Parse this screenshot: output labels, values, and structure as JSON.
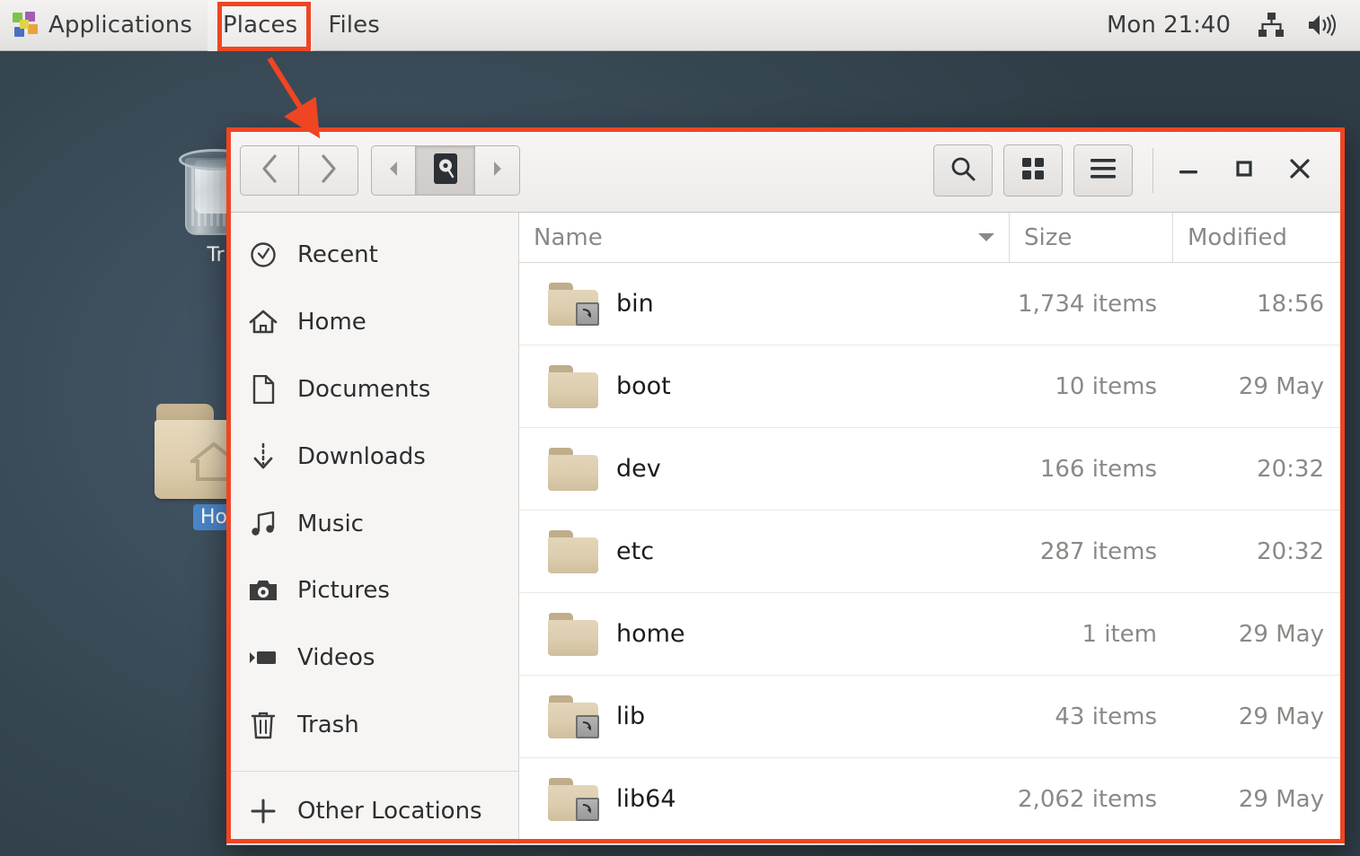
{
  "panel": {
    "app_launcher_icon": "applications-pinwheel-icon",
    "applications_label": "Applications",
    "places_label": "Places",
    "files_label": "Files",
    "clock": "Mon 21:40",
    "network_icon": "network-tree-icon",
    "volume_icon": "volume-speaker-icon"
  },
  "desktop": {
    "trash": {
      "label": "Tr",
      "icon": "trash-can-icon"
    },
    "home": {
      "label": "Ho",
      "icon": "home-folder-icon",
      "selected": true
    },
    "background_color": "#3d4e5c"
  },
  "annotations": {
    "accent_color": "#ef4523",
    "places_highlight": "places-menu-box",
    "window_highlight": "file-manager-window-box",
    "arrow": "red-arrow-places-to-window"
  },
  "file_manager": {
    "header": {
      "back_icon": "chevron-left-icon",
      "forward_icon": "chevron-right-icon",
      "path_prev_icon": "triangle-left-icon",
      "path_root_icon": "hard-drive-icon",
      "path_next_icon": "triangle-right-icon",
      "search_icon": "search-icon",
      "grid_view_icon": "grid-view-icon",
      "menu_icon": "hamburger-menu-icon",
      "minimize_icon": "minimize-icon",
      "maximize_icon": "maximize-icon",
      "close_icon": "close-icon"
    },
    "sidebar": {
      "items": [
        {
          "label": "Recent",
          "icon": "clock-icon"
        },
        {
          "label": "Home",
          "icon": "house-icon"
        },
        {
          "label": "Documents",
          "icon": "document-icon"
        },
        {
          "label": "Downloads",
          "icon": "download-arrow-icon"
        },
        {
          "label": "Music",
          "icon": "music-note-icon"
        },
        {
          "label": "Pictures",
          "icon": "camera-icon"
        },
        {
          "label": "Videos",
          "icon": "video-camera-icon"
        },
        {
          "label": "Trash",
          "icon": "trash-bin-icon"
        }
      ],
      "other_locations": {
        "label": "Other Locations",
        "icon": "plus-icon"
      }
    },
    "columns": {
      "name": "Name",
      "size": "Size",
      "modified": "Modified",
      "sort_column": "Name",
      "sort_direction": "descending"
    },
    "rows": [
      {
        "name": "bin",
        "size": "1,734 items",
        "modified": "18:56",
        "symlink": true
      },
      {
        "name": "boot",
        "size": "10 items",
        "modified": "29 May",
        "symlink": false
      },
      {
        "name": "dev",
        "size": "166 items",
        "modified": "20:32",
        "symlink": false
      },
      {
        "name": "etc",
        "size": "287 items",
        "modified": "20:32",
        "symlink": false
      },
      {
        "name": "home",
        "size": "1 item",
        "modified": "29 May",
        "symlink": false
      },
      {
        "name": "lib",
        "size": "43 items",
        "modified": "29 May",
        "symlink": true
      },
      {
        "name": "lib64",
        "size": "2,062 items",
        "modified": "29 May",
        "symlink": true
      }
    ]
  }
}
